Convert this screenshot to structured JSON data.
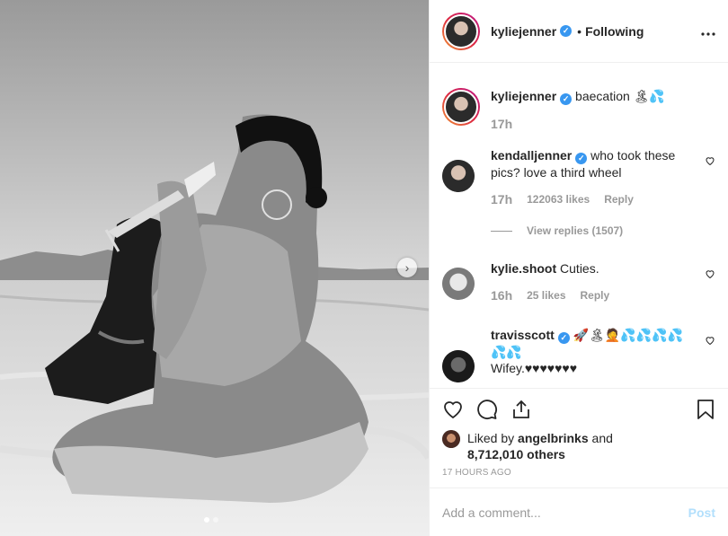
{
  "post": {
    "author": "kyliejenner",
    "follow_status": "Following",
    "more_label": "•••",
    "caption": "baecation 🏝💦",
    "caption_time": "17h"
  },
  "comments": [
    {
      "username": "kendalljenner",
      "verified": true,
      "text": "who took these pics? love a third wheel",
      "time": "17h",
      "likes": "122063 likes",
      "reply_label": "Reply",
      "view_replies": "View replies (1507)"
    },
    {
      "username": "kylie.shoot",
      "verified": false,
      "text": "Cuties.",
      "time": "16h",
      "likes": "25 likes",
      "reply_label": "Reply"
    },
    {
      "username": "travisscott",
      "verified": true,
      "text_line1": "🚀🏝🤦💦💦💦💦",
      "text_line2": "💦💦",
      "text_line3": "Wifey.♥♥♥♥♥♥♥"
    }
  ],
  "likes": {
    "prefix": "Liked by",
    "liker": "angelbrinks",
    "middle": "and",
    "count": "8,712,010 others"
  },
  "timestamp": "17 HOURS AGO",
  "add_comment": {
    "placeholder": "Add a comment...",
    "post_label": "Post"
  },
  "carousel": {
    "count": 2,
    "active": 1
  },
  "colors": {
    "verified": "#3897f0",
    "post_button_disabled": "#b2dffc",
    "secondary_text": "#999999"
  }
}
